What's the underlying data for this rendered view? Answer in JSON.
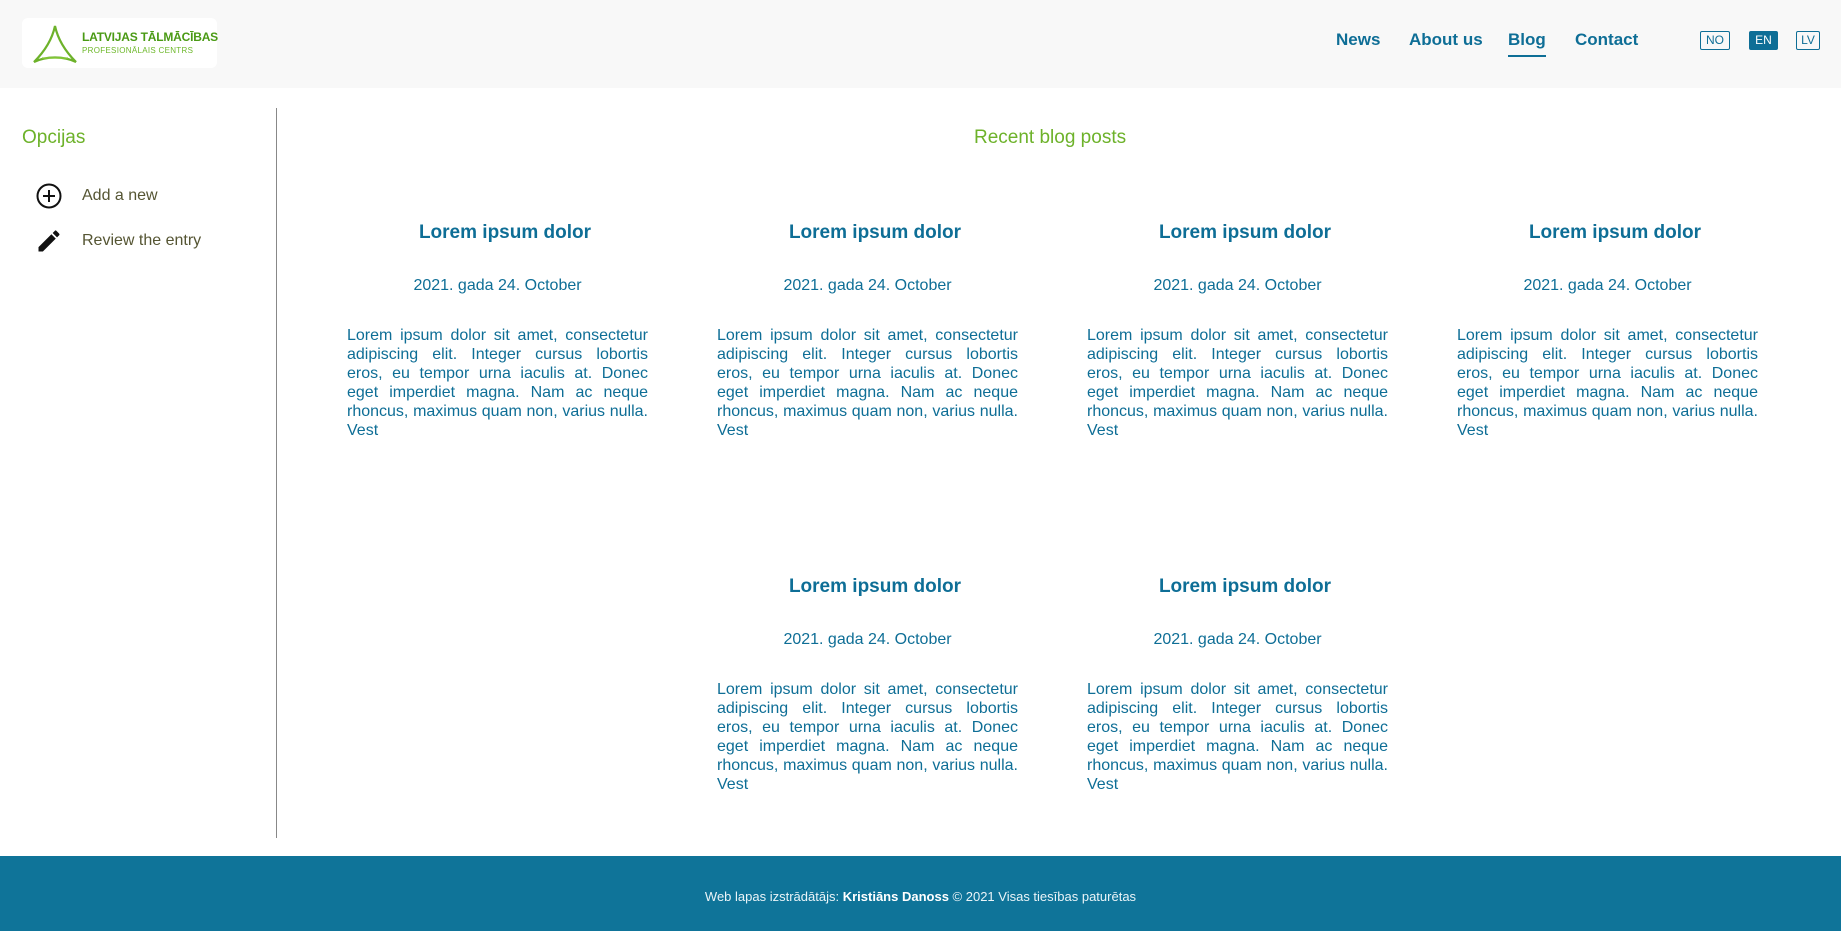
{
  "header": {
    "logo": {
      "line1": "LATVIJAS TĀLMĀCĪBAS",
      "line2": "PROFESIONĀLAIS CENTRS"
    },
    "nav": [
      {
        "label": "News",
        "active": false
      },
      {
        "label": "About us",
        "active": false
      },
      {
        "label": "Blog",
        "active": true
      },
      {
        "label": "Contact",
        "active": false
      }
    ],
    "languages": [
      {
        "label": "NO",
        "active": false
      },
      {
        "label": "EN",
        "active": true
      },
      {
        "label": "LV",
        "active": false
      }
    ]
  },
  "sidebar": {
    "title": "Opcijas",
    "items": [
      {
        "label": "Add a new",
        "icon": "add-circle-icon"
      },
      {
        "label": "Review the entry",
        "icon": "pencil-icon"
      }
    ]
  },
  "main": {
    "title": "Recent blog posts",
    "posts": [
      {
        "title": "Lorem ipsum dolor",
        "date": "2021. gada 24. October",
        "body": "Lorem ipsum dolor sit amet, consectetur adipiscing elit. Integer cursus lobortis eros, eu tempor urna iaculis at. Donec eget imperdiet magna. Nam ac neque rhoncus, maximus quam non, varius nulla. Vest"
      },
      {
        "title": "Lorem ipsum dolor",
        "date": "2021. gada 24. October",
        "body": "Lorem ipsum dolor sit amet, consectetur adipiscing elit. Integer cursus lobortis eros, eu tempor urna iaculis at. Donec eget imperdiet magna. Nam ac neque rhoncus, maximus quam non, varius nulla. Vest"
      },
      {
        "title": "Lorem ipsum dolor",
        "date": "2021. gada 24. October",
        "body": "Lorem ipsum dolor sit amet, consectetur adipiscing elit. Integer cursus lobortis eros, eu tempor urna iaculis at. Donec eget imperdiet magna. Nam ac neque rhoncus, maximus quam non, varius nulla. Vest"
      },
      {
        "title": "Lorem ipsum dolor",
        "date": "2021. gada 24. October",
        "body": "Lorem ipsum dolor sit amet, consectetur adipiscing elit. Integer cursus lobortis eros, eu tempor urna iaculis at. Donec eget imperdiet magna. Nam ac neque rhoncus, maximus quam non, varius nulla. Vest"
      },
      {
        "title": "Lorem ipsum dolor",
        "date": "2021. gada 24. October",
        "body": "Lorem ipsum dolor sit amet, consectetur adipiscing elit. Integer cursus lobortis eros, eu tempor urna iaculis at. Donec eget imperdiet magna. Nam ac neque rhoncus, maximus quam non, varius nulla. Vest"
      },
      {
        "title": "Lorem ipsum dolor",
        "date": "2021. gada 24. October",
        "body": "Lorem ipsum dolor sit amet, consectetur adipiscing elit. Integer cursus lobortis eros, eu tempor urna iaculis at. Donec eget imperdiet magna. Nam ac neque rhoncus, maximus quam non, varius nulla. Vest"
      }
    ]
  },
  "footer": {
    "prefix": "Web lapas izstrādātājs:",
    "author": "Kristiāns Danoss",
    "suffix": "© 2021 Visas tiesības paturētas"
  },
  "colors": {
    "primary": "#0e6e96",
    "accent_green": "#6db22a",
    "footer_bg": "#0f7499",
    "header_bg": "#f8f8f8"
  }
}
